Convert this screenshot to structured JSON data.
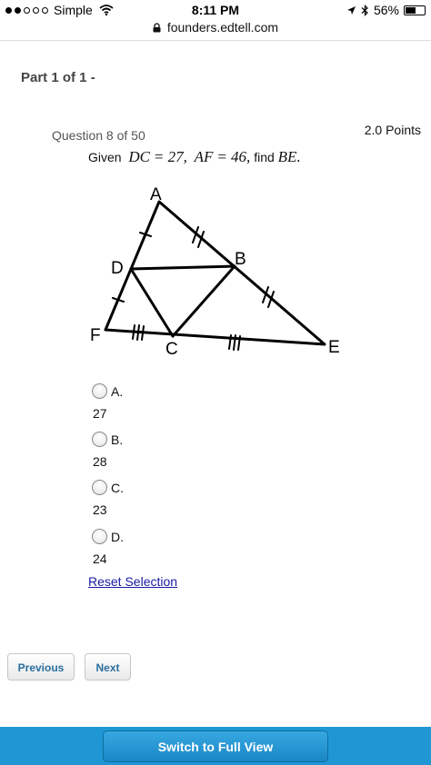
{
  "status_bar": {
    "carrier": "Simple",
    "time": "8:11 PM",
    "battery_text": "56%",
    "battery_level": 0.56
  },
  "browser": {
    "url": "founders.edtell.com"
  },
  "part_title": "Part 1 of 1 -",
  "question": {
    "number_label": "Question 8 of 50",
    "points": "2.0 Points",
    "prompt_prefix": "Given",
    "math_dc": "DC",
    "math_dc_value": "= 27,",
    "math_af": "AF",
    "math_af_value": "= 46,",
    "prompt_suffix": "find",
    "math_be": "BE",
    "math_end": "."
  },
  "figure": {
    "labels": {
      "A": "A",
      "B": "B",
      "C": "C",
      "D": "D",
      "E": "E",
      "F": "F"
    }
  },
  "choices": [
    {
      "letter": "A.",
      "value": "27"
    },
    {
      "letter": "B.",
      "value": "28"
    },
    {
      "letter": "C.",
      "value": "23"
    },
    {
      "letter": "D.",
      "value": "24"
    }
  ],
  "reset_label": "Reset Selection",
  "nav": {
    "previous": "Previous",
    "next": "Next"
  },
  "bottom": {
    "full_view": "Switch to Full View"
  }
}
